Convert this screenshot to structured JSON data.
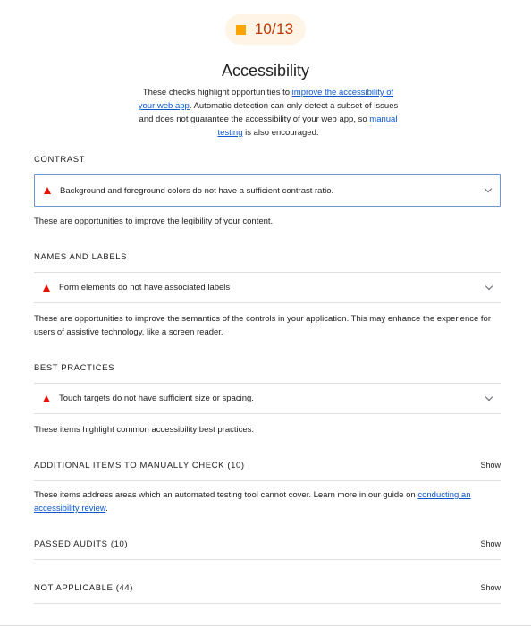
{
  "score": {
    "value": "10/13",
    "color": "#ffa400",
    "text_color": "#c33300"
  },
  "category": {
    "title": "Accessibility",
    "description": {
      "part1": "These checks highlight opportunities to ",
      "link1": "improve the accessibility of your web app",
      "part2": ". Automatic detection can only detect a subset of issues and does not guarantee the accessibility of your web app, so ",
      "link2": "manual testing",
      "part3": " is also encouraged."
    }
  },
  "groups": {
    "contrast": {
      "title": "CONTRAST",
      "audit": "Background and foreground colors do not have a sufficient contrast ratio.",
      "description": "These are opportunities to improve the legibility of your content."
    },
    "names_labels": {
      "title": "NAMES AND LABELS",
      "audit": "Form elements do not have associated labels",
      "description": "These are opportunities to improve the semantics of the controls in your application. This may enhance the experience for users of assistive technology, like a screen reader."
    },
    "best_practices": {
      "title": "BEST PRACTICES",
      "audit": "Touch targets do not have sufficient size or spacing.",
      "description": "These items highlight common accessibility best practices."
    },
    "manual": {
      "title": "ADDITIONAL ITEMS TO MANUALLY CHECK (10)",
      "show": "Show",
      "description_part1": "These items address areas which an automated testing tool cannot cover. Learn more in our guide on ",
      "description_link": "conducting an accessibility review",
      "description_part2": "."
    },
    "passed": {
      "title": "PASSED AUDITS (10)",
      "show": "Show"
    },
    "not_applicable": {
      "title": "NOT APPLICABLE (44)",
      "show": "Show"
    }
  },
  "icons": {
    "fail": "red-triangle-icon",
    "expand": "chevron-down-icon"
  },
  "colors": {
    "fail": "#eb0f00",
    "link": "#0b57d0",
    "focus_border": "#6f97d8"
  }
}
